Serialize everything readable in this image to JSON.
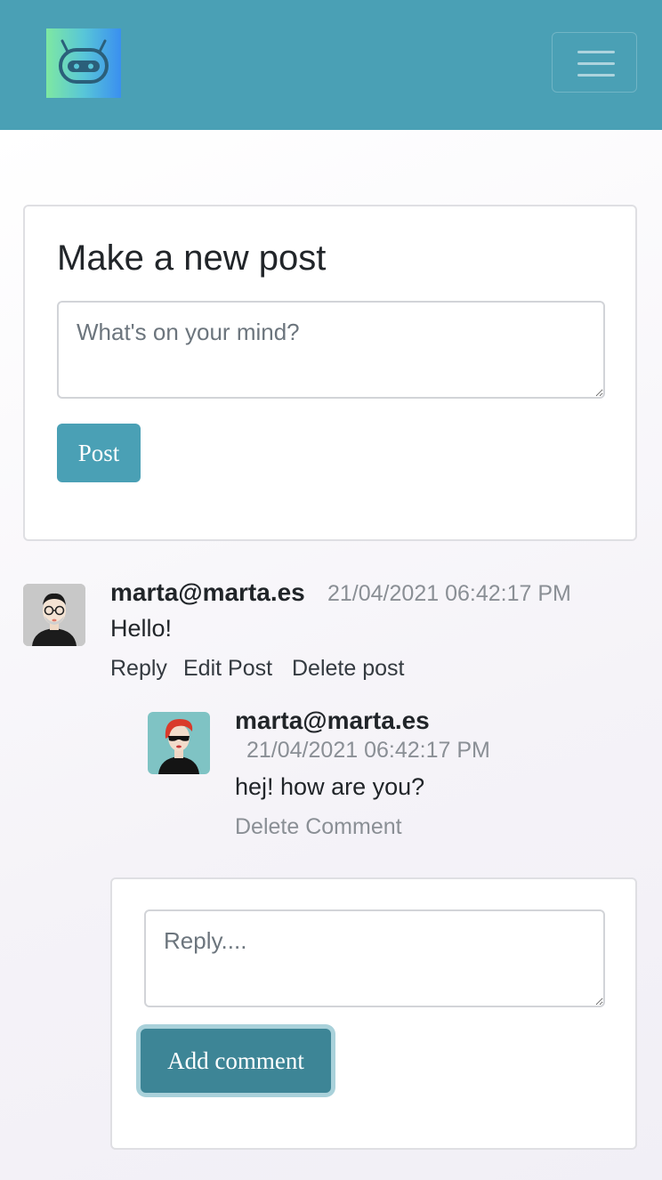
{
  "new_post": {
    "title": "Make a new post",
    "placeholder": "What's on your mind?",
    "button_label": "Post"
  },
  "post": {
    "author": "marta@marta.es",
    "timestamp": "21/04/2021 06:42:17 PM",
    "text": "Hello!",
    "actions": {
      "reply": "Reply",
      "edit": "Edit Post",
      "delete": "Delete post"
    }
  },
  "comment": {
    "author": "marta@marta.es",
    "timestamp": "21/04/2021 06:42:17 PM",
    "text": "hej! how are you?",
    "delete_label": "Delete Comment"
  },
  "reply_form": {
    "placeholder": "Reply....",
    "button_label": "Add comment"
  },
  "colors": {
    "brand": "#4aa0b5",
    "brand_dark": "#3d8596"
  }
}
